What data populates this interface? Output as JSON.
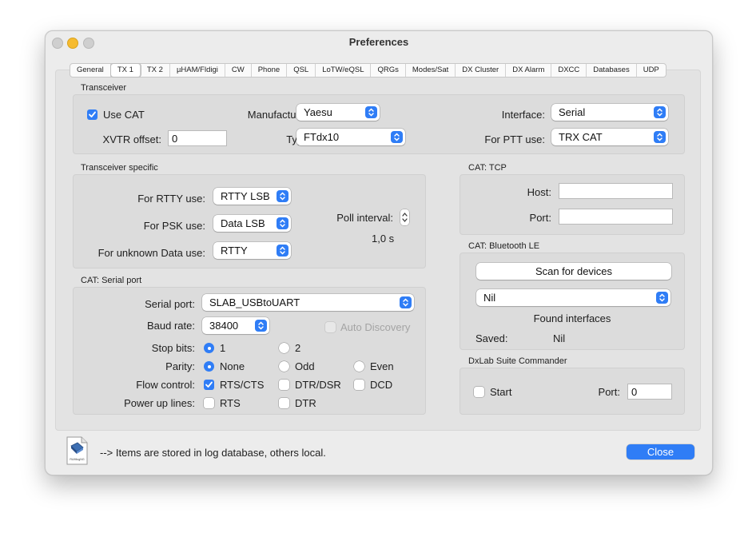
{
  "window": {
    "title": "Preferences"
  },
  "tabs": [
    "General",
    "TX 1",
    "TX 2",
    "µHAM/Fldigi",
    "CW",
    "Phone",
    "QSL",
    "LoTW/eQSL",
    "QRGs",
    "Modes/Sat",
    "DX Cluster",
    "DX Alarm",
    "DXCC",
    "Databases",
    "UDP"
  ],
  "active_tab": "TX 1",
  "colors": {
    "accent": "#2f7df6",
    "window_bg": "#ececec"
  },
  "transceiver": {
    "title": "Transceiver",
    "use_cat_label": "Use CAT",
    "use_cat_checked": true,
    "manufacturer_label": "Manufacturer:",
    "manufacturer_value": "Yaesu",
    "interface_label": "Interface:",
    "interface_value": "Serial",
    "xvtr_label": "XVTR offset:",
    "xvtr_value": "0",
    "type_label": "Type:",
    "type_value": "FTdx10",
    "ptt_label": "For PTT use:",
    "ptt_value": "TRX CAT"
  },
  "transceiver_specific": {
    "title": "Transceiver specific",
    "rtty_label": "For RTTY use:",
    "rtty_value": "RTTY LSB",
    "psk_label": "For PSK use:",
    "psk_value": "Data LSB",
    "unknown_label": "For unknown Data use:",
    "unknown_value": "RTTY",
    "poll_label": "Poll interval:",
    "poll_value": "1,0 s"
  },
  "serial_port": {
    "title": "CAT: Serial port",
    "port_label": "Serial port:",
    "port_value": "SLAB_USBtoUART",
    "baud_label": "Baud rate:",
    "baud_value": "38400",
    "auto_discovery_label": "Auto Discovery",
    "stop_bits_label": "Stop bits:",
    "stop_bits_options": [
      "1",
      "2"
    ],
    "stop_bits_selected": "1",
    "parity_label": "Parity:",
    "parity_options": [
      "None",
      "Odd",
      "Even"
    ],
    "parity_selected": "None",
    "flow_label": "Flow control:",
    "flow_options": [
      "RTS/CTS",
      "DTR/DSR",
      "DCD"
    ],
    "flow_checked": [
      "RTS/CTS"
    ],
    "power_label": "Power up lines:",
    "power_options": [
      "RTS",
      "DTR"
    ]
  },
  "cat_tcp": {
    "title": "CAT: TCP",
    "host_label": "Host:",
    "host_value": "",
    "port_label": "Port:",
    "port_value": ""
  },
  "bluetooth": {
    "title": "CAT: Bluetooth LE",
    "scan_label": "Scan for devices",
    "device_value": "Nil",
    "found_label": "Found interfaces",
    "saved_label": "Saved:",
    "saved_value": "Nil"
  },
  "dxlab": {
    "title": "DxLab Suite Commander",
    "start_label": "Start",
    "port_label": "Port:",
    "port_value": "0"
  },
  "footer": {
    "note": "--> Items are stored in log database, others local.",
    "close_label": "Close",
    "icon_caption": "RUMlogNG"
  }
}
